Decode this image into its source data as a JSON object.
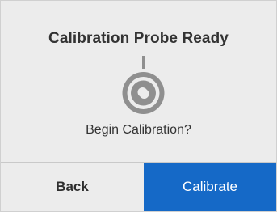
{
  "dialog": {
    "title": "Calibration Probe Ready",
    "question": "Begin Calibration?",
    "icon": "calibration-probe-icon"
  },
  "buttons": {
    "back_label": "Back",
    "calibrate_label": "Calibrate"
  },
  "colors": {
    "background": "#ececec",
    "primary_button": "#1569c7",
    "icon_gray": "#8f8f8f",
    "text": "#333333"
  }
}
